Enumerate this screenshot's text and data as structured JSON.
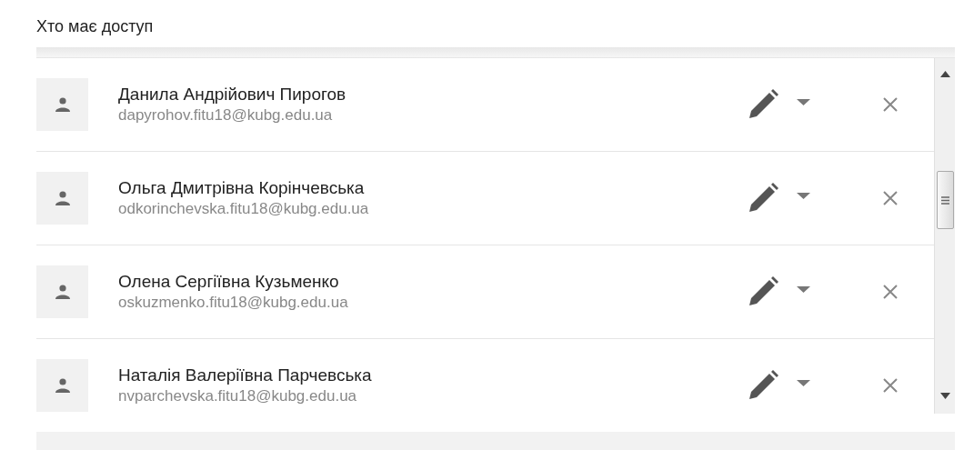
{
  "title": "Хто має доступ",
  "people": [
    {
      "name": "Данила Андрійович Пирогов",
      "email": "dapyrohov.fitu18@kubg.edu.ua"
    },
    {
      "name": "Ольга Дмитрівна Корінчевська",
      "email": "odkorinchevska.fitu18@kubg.edu.ua"
    },
    {
      "name": "Олена Сергіївна Кузьменко",
      "email": "oskuzmenko.fitu18@kubg.edu.ua"
    },
    {
      "name": "Наталія Валеріївна Парчевська",
      "email": "nvparchevska.fitu18@kubg.edu.ua"
    }
  ]
}
